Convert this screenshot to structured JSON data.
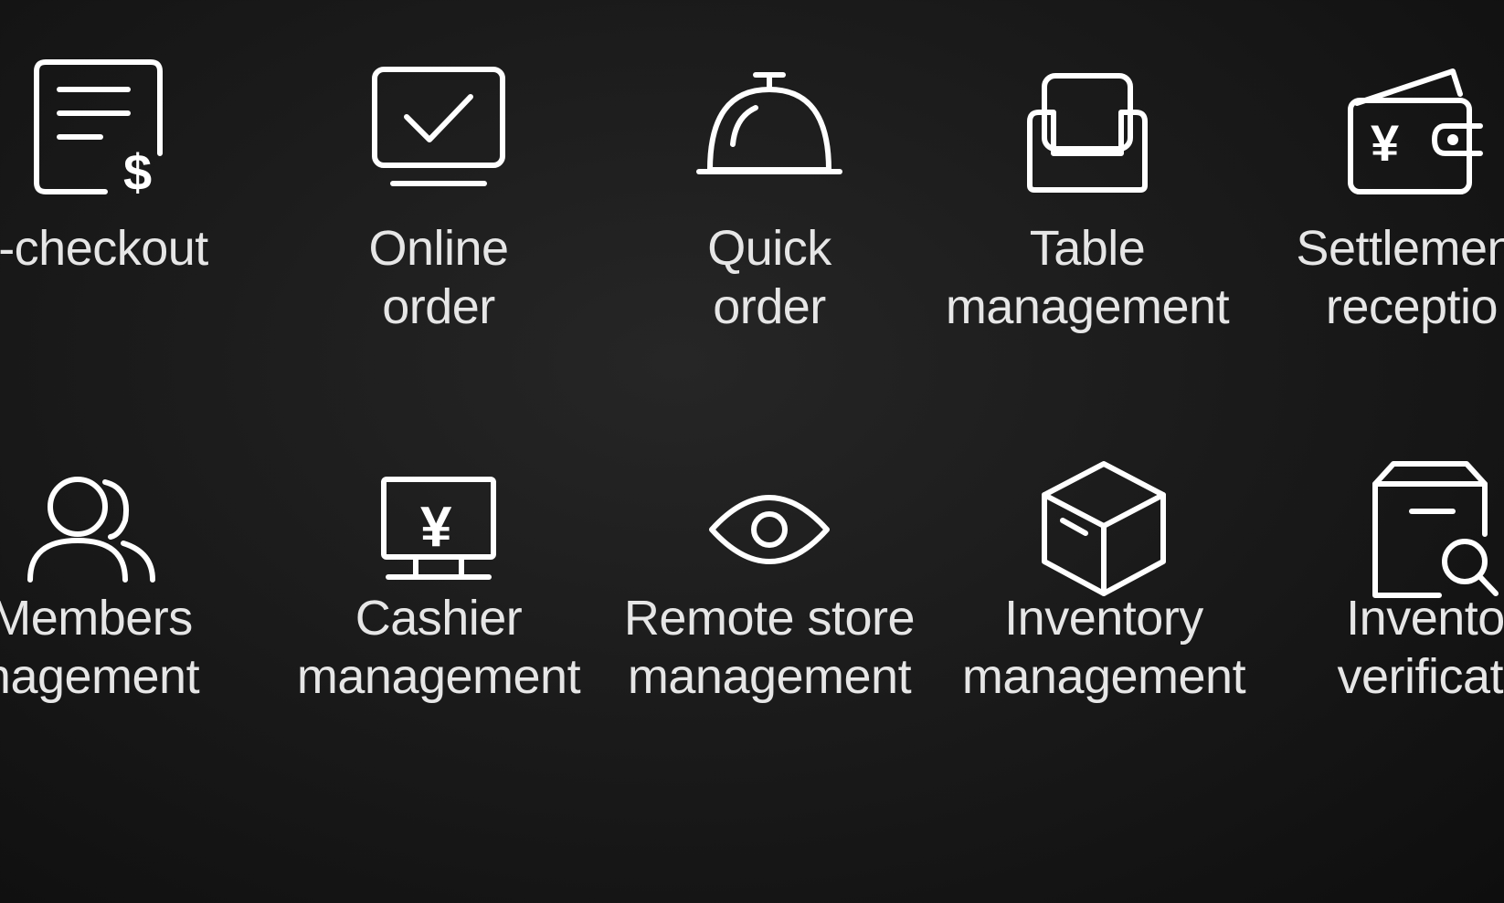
{
  "background_color": "#151515",
  "text_color": "#e6e6e6",
  "icon_color": "#ffffff",
  "rows": [
    {
      "items": [
        {
          "icon": "receipt-dollar-icon",
          "line1": "lf-checkout",
          "line2": ""
        },
        {
          "icon": "monitor-check-icon",
          "line1": "Online",
          "line2": "order"
        },
        {
          "icon": "service-bell-icon",
          "line1": "Quick",
          "line2": "order"
        },
        {
          "icon": "armchair-icon",
          "line1": "Table",
          "line2": "management"
        },
        {
          "icon": "wallet-yuan-icon",
          "line1": "Settlement",
          "line2": "receptio"
        }
      ]
    },
    {
      "items": [
        {
          "icon": "members-icon",
          "line1": "Members",
          "line2": "nagement"
        },
        {
          "icon": "cashier-monitor-yuan-icon",
          "line1": "Cashier",
          "line2": "management"
        },
        {
          "icon": "eye-icon",
          "line1": "Remote store",
          "line2": "management"
        },
        {
          "icon": "box-icon",
          "line1": "Inventory",
          "line2": "management"
        },
        {
          "icon": "box-search-icon",
          "line1": "Invento",
          "line2": "verificati"
        }
      ]
    }
  ]
}
